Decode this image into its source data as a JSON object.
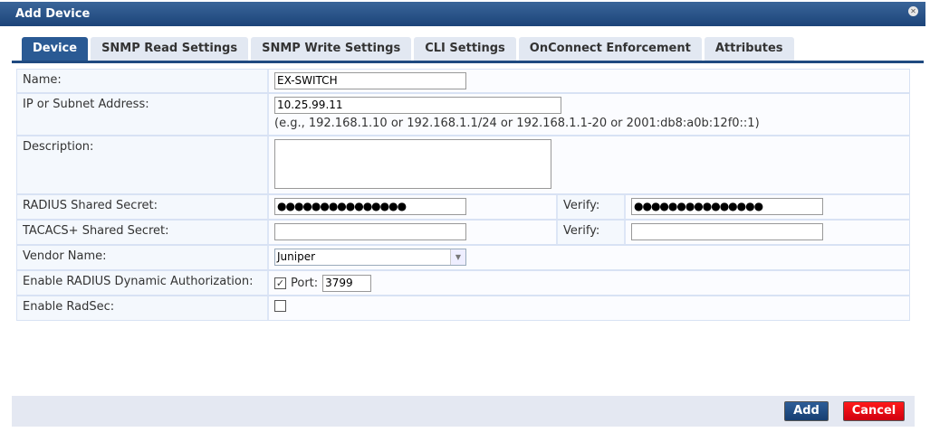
{
  "dialog": {
    "title": "Add Device",
    "close_icon": "close-icon"
  },
  "tabs": [
    "Device",
    "SNMP Read Settings",
    "SNMP Write Settings",
    "CLI Settings",
    "OnConnect Enforcement",
    "Attributes"
  ],
  "form": {
    "name_label": "Name:",
    "name_value": "EX-SWITCH",
    "ip_label": "IP or Subnet Address:",
    "ip_value": "10.25.99.11",
    "ip_hint": "(e.g., 192.168.1.10 or 192.168.1.1/24 or 192.168.1.1-20 or 2001:db8:a0b:12f0::1)",
    "description_label": "Description:",
    "description_value": "",
    "radius_label": "RADIUS Shared Secret:",
    "radius_value": "●●●●●●●●●●●●●●●",
    "verify_label": "Verify:",
    "radius_verify_value": "●●●●●●●●●●●●●●●",
    "tacacs_label": "TACACS+ Shared Secret:",
    "tacacs_value": "",
    "tacacs_verify_value": "",
    "vendor_label": "Vendor Name:",
    "vendor_value": "Juniper",
    "dynauth_label": "Enable RADIUS Dynamic Authorization:",
    "dynauth_checked": true,
    "port_label": "Port:",
    "port_value": "3799",
    "radsec_label": "Enable RadSec:",
    "radsec_checked": false
  },
  "footer": {
    "add_label": "Add",
    "cancel_label": "Cancel",
    "add_color": "#1f4a80",
    "cancel_color": "#e00010"
  }
}
